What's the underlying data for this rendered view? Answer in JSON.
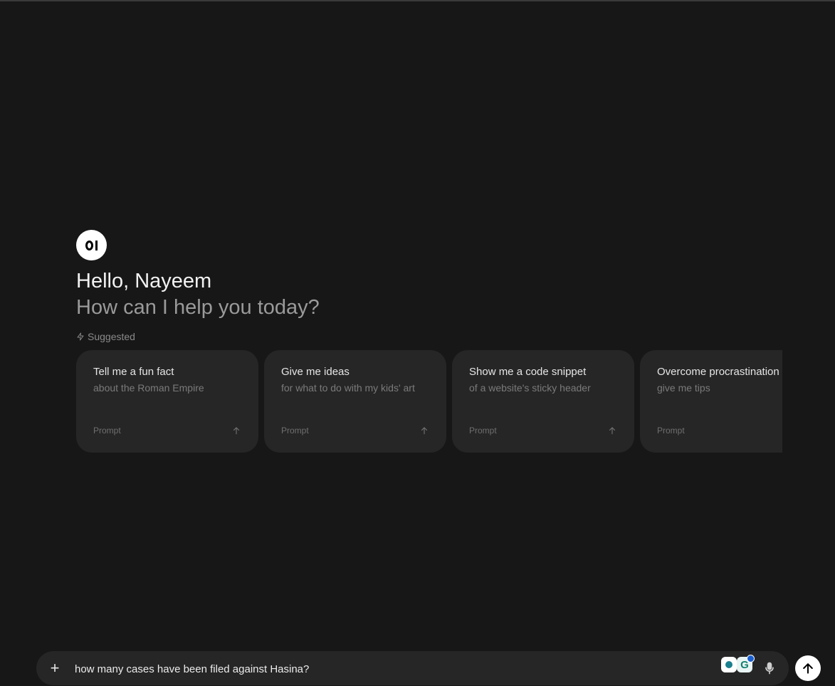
{
  "welcome": {
    "logo_text": "OI",
    "greeting": "Hello, Nayeem",
    "subtitle": "How can I help you today?"
  },
  "suggested": {
    "label": "Suggested",
    "icon": "bolt-icon",
    "cards": [
      {
        "title": "Tell me a fun fact",
        "subtitle": "about the Roman Empire",
        "footer": "Prompt"
      },
      {
        "title": "Give me ideas",
        "subtitle": "for what to do with my kids' art",
        "footer": "Prompt"
      },
      {
        "title": "Show me a code snippet",
        "subtitle": "of a website's sticky header",
        "footer": "Prompt"
      },
      {
        "title": "Overcome procrastination",
        "subtitle": "give me tips",
        "footer": "Prompt"
      }
    ]
  },
  "input": {
    "value": "how many cases have been filed against Hasina?",
    "add_icon": "plus-icon",
    "mic_icon": "microphone-icon",
    "send_icon": "arrow-up-icon"
  },
  "colors": {
    "background": "#171717",
    "card": "#262626",
    "send_button": "#ffffff"
  }
}
